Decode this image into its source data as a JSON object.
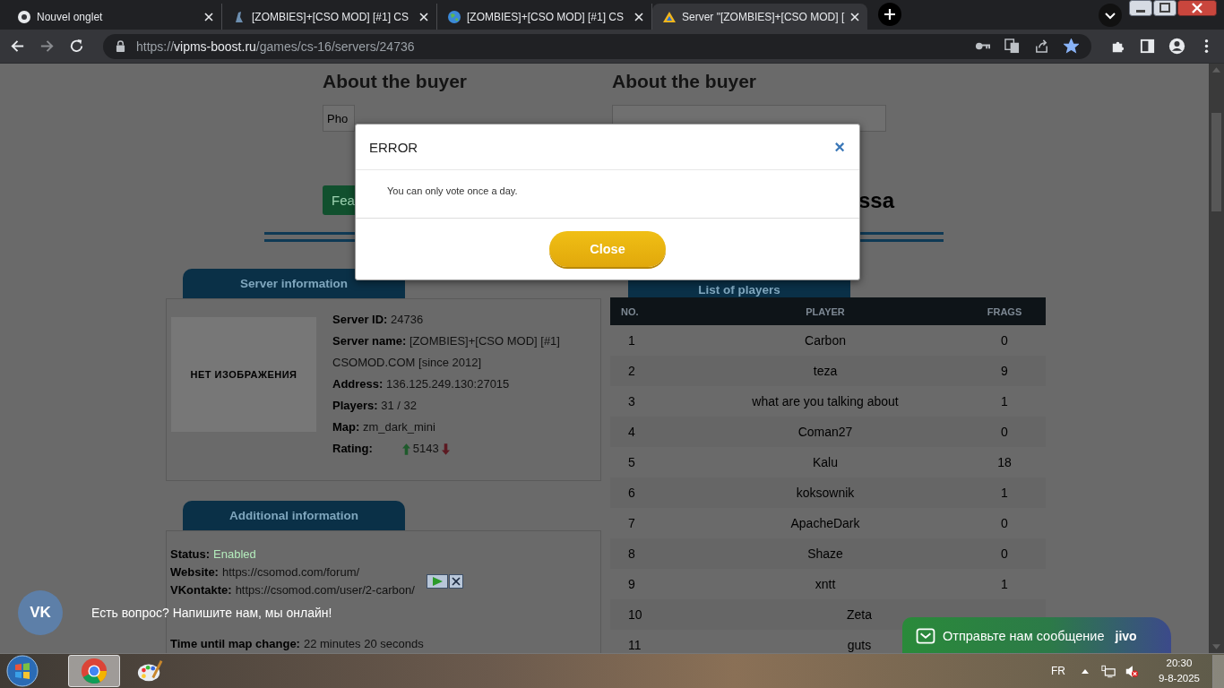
{
  "browser": {
    "tabs": [
      {
        "title": "Nouvel onglet",
        "selected": false
      },
      {
        "title": "[ZOMBIES]+[CSO MOD] [#1] CS",
        "selected": false
      },
      {
        "title": "[ZOMBIES]+[CSO MOD] [#1] CS",
        "selected": false
      },
      {
        "title": "Server \"[ZOMBIES]+[CSO MOD] [",
        "selected": true
      }
    ],
    "url": {
      "scheme": "https://",
      "host": "vipms-boost.ru",
      "path": "/games/cs-16/servers/24736"
    },
    "bookmarked": true
  },
  "buyer_sections": [
    {
      "heading": "About the buyer",
      "placeholder": "Pho"
    },
    {
      "heading": "About the buyer"
    }
  ],
  "feature_button": "Fea",
  "side_text": "ssa",
  "server_info": {
    "tab": "Server information",
    "image_text": "НЕТ ИЗОБРАЖЕНИЯ",
    "fields": [
      {
        "label": "Server ID:",
        "value": "24736"
      },
      {
        "label": "Server name:",
        "value": "[ZOMBIES]+[CSO MOD] [#1] CSOMOD.COM [since 2012]"
      },
      {
        "label": "Address:",
        "value": "136.125.249.130:27015"
      },
      {
        "label": "Players:",
        "value": "31 / 32"
      },
      {
        "label": "Map:",
        "value": "zm_dark_mini"
      }
    ],
    "rating": {
      "label": "Rating:",
      "value": "5143"
    }
  },
  "additional_info": {
    "tab": "Additional information",
    "fields": [
      {
        "label": "Status:",
        "value": "Enabled",
        "kind": "status"
      },
      {
        "label": "Website:",
        "value": "https://csomod.com/forum/",
        "kind": "link"
      },
      {
        "label": "VKontakte:",
        "value": "https://csomod.com/user/2-carbon/",
        "kind": "link"
      },
      {
        "label": "Time until map change:",
        "value": "22 minutes 20 seconds",
        "kind": "text"
      }
    ]
  },
  "players": {
    "tab": "List of players",
    "columns": [
      "NO.",
      "PLAYER",
      "FRAGS"
    ],
    "rows": [
      {
        "no": "1",
        "player": "Carbon",
        "frags": "0"
      },
      {
        "no": "2",
        "player": "teza",
        "frags": "9"
      },
      {
        "no": "3",
        "player": "what are you talking about",
        "frags": "1"
      },
      {
        "no": "4",
        "player": "Coman27",
        "frags": "0"
      },
      {
        "no": "5",
        "player": "Kalu",
        "frags": "18"
      },
      {
        "no": "6",
        "player": "koksownik",
        "frags": "1"
      },
      {
        "no": "7",
        "player": "ApacheDark",
        "frags": "0"
      },
      {
        "no": "8",
        "player": "Shaze",
        "frags": "0"
      },
      {
        "no": "9",
        "player": "xntt",
        "frags": "1"
      },
      {
        "no": "10",
        "player": "Zeta"
      },
      {
        "no": "11",
        "player": "guts"
      }
    ]
  },
  "modal": {
    "title": "ERROR",
    "close": "×",
    "message": "You can only vote once a day.",
    "button": "Close"
  },
  "vk_widget": {
    "logo": "VK",
    "text": "Есть вопрос? Напишите нам, мы онлайн!"
  },
  "jivo_widget": {
    "text": "Отправьте нам сообщение",
    "brand": "jivo"
  },
  "taskbar": {
    "language": "FR",
    "time": "20:30",
    "date": "9-8-2025"
  }
}
